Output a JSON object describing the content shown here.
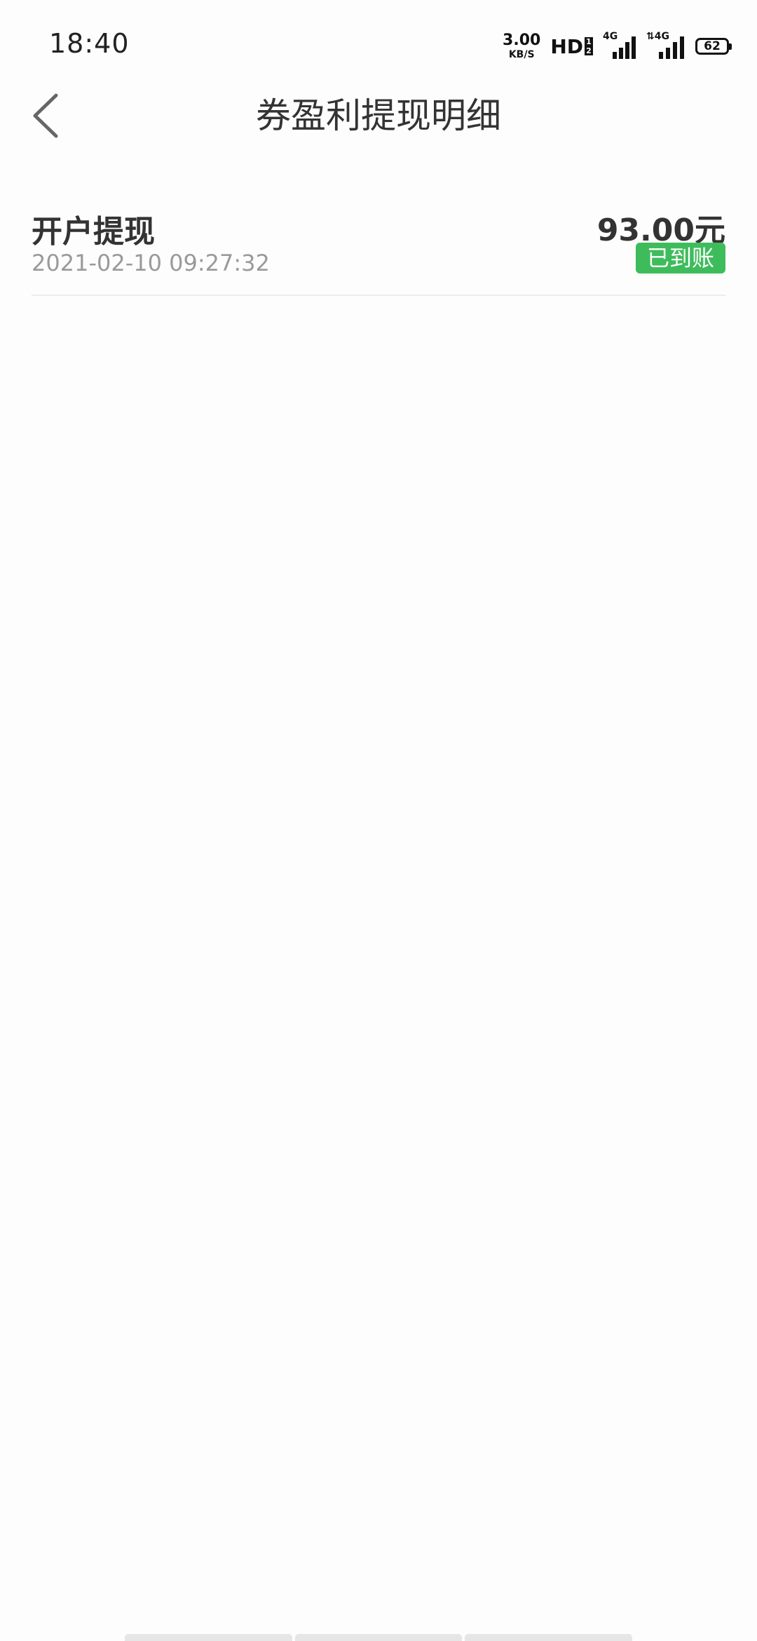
{
  "status_bar": {
    "time": "18:40",
    "net_speed_value": "3.00",
    "net_speed_unit": "KB/S",
    "hd_label": "HD",
    "hd_sim": "1\n2",
    "signal_1_label": "4G",
    "signal_2_label": "⇅4G",
    "battery_level": "62"
  },
  "header": {
    "title": "券盈利提现明细"
  },
  "records": [
    {
      "title": "开户提现",
      "time": "2021-02-10 09:27:32",
      "amount": "93.00元",
      "status": "已到账"
    }
  ],
  "colors": {
    "status_success": "#3ebc5b",
    "divider": "#ececec",
    "text_secondary": "#9a9a9a"
  },
  "icons": {
    "back": "chevron-left-icon",
    "signal": "cell-signal-icon",
    "battery": "battery-icon"
  }
}
